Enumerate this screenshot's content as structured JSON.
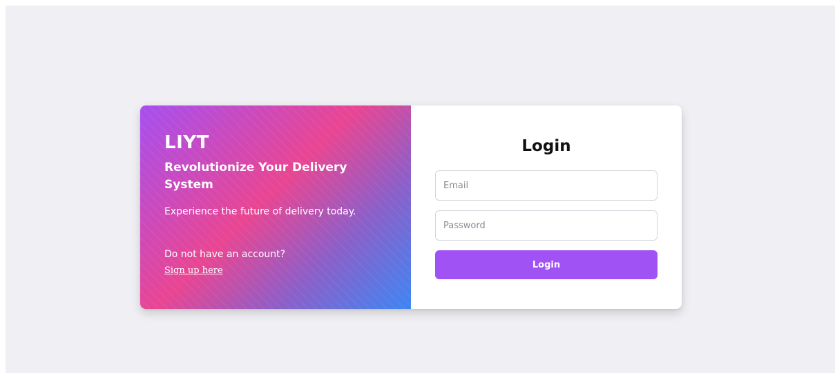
{
  "promo": {
    "brand": "LIYT",
    "headline": "Revolutionize Your Delivery System",
    "subtitle": "Experience the future of delivery today.",
    "no_account_text": "Do not have an account?",
    "signup_link": "Sign up here"
  },
  "login": {
    "title": "Login",
    "email": {
      "placeholder": "Email",
      "value": ""
    },
    "password": {
      "placeholder": "Password",
      "value": ""
    },
    "submit_label": "Login"
  },
  "colors": {
    "page_background": "#f0f0f4",
    "gradient_purple": "#a64ff0",
    "gradient_pink": "#e94592",
    "gradient_blue": "#3d86f3",
    "button": "#a052f4"
  }
}
